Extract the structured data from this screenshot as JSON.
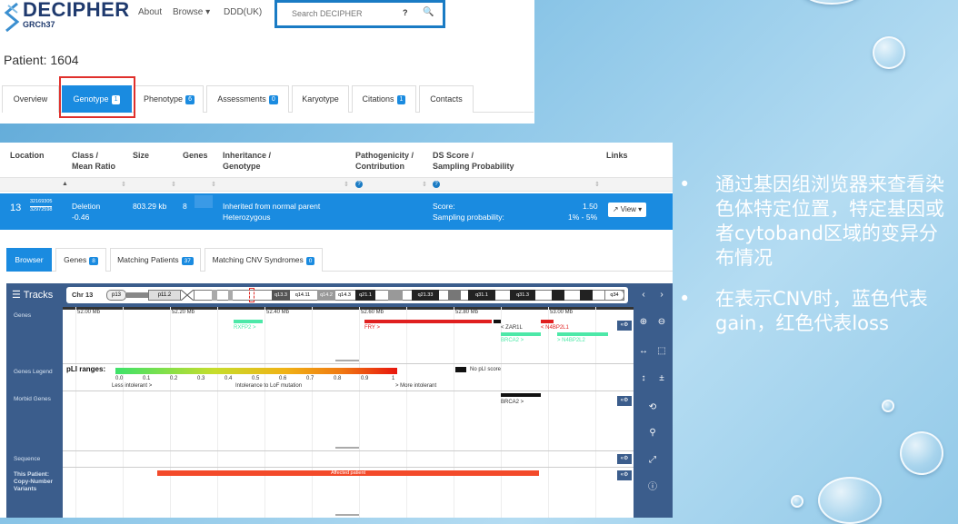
{
  "header": {
    "logo_text": "DECIPHER",
    "logo_sub": "GRCh37",
    "nav": [
      "About",
      "Browse ▾",
      "DDD(UK)"
    ],
    "search_placeholder": "Search DECIPHER",
    "help_icon": "?",
    "search_icon": "🔍"
  },
  "patient_label": "Patient: 1604",
  "tabs": [
    {
      "label": "Overview",
      "badge": ""
    },
    {
      "label": "Genotype",
      "badge": "1"
    },
    {
      "label": "Phenotype",
      "badge": "6"
    },
    {
      "label": "Assessments",
      "badge": "0"
    },
    {
      "label": "Karyotype",
      "badge": ""
    },
    {
      "label": "Citations",
      "badge": "1"
    },
    {
      "label": "Contacts",
      "badge": ""
    }
  ],
  "table": {
    "headers": {
      "location": "Location",
      "class": "Class /\nMean Ratio",
      "size": "Size",
      "genes": "Genes",
      "inheritance": "Inheritance /\nGenotype",
      "pathogenicity": "Pathogenicity /\nContribution",
      "ds": "DS Score /\nSampling Probability",
      "links": "Links"
    },
    "row": {
      "chr": "13",
      "start": "32169305",
      "end": "32972598",
      "class": "Deletion",
      "ratio": "-0.46",
      "size": "803.29 kb",
      "genes": "8",
      "inheritance": "Inherited from normal parent",
      "genotype": "Heterozygous",
      "score_label": "Score:",
      "score_value": "1.50",
      "sampling_label": "Sampling probability:",
      "sampling_value": "1% - 5%",
      "view": "View ▾"
    }
  },
  "subtabs": [
    {
      "label": "Browser",
      "badge": ""
    },
    {
      "label": "Genes",
      "badge": "8"
    },
    {
      "label": "Matching Patients",
      "badge": "37"
    },
    {
      "label": "Matching CNV Syndromes",
      "badge": "0"
    }
  ],
  "browser": {
    "tracks_label": "☰ Tracks",
    "chr_label": "Chr 13",
    "bands": [
      "p13",
      "p11.2",
      "q13.3",
      "q14.11",
      "q14.2",
      "q14.3",
      "q21.1",
      "q21.33",
      "q31.1",
      "q31.3",
      "q34"
    ],
    "ruler": [
      "52.00 Mb",
      "52.20 Mb",
      "52.40 Mb",
      "52.60 Mb",
      "52.80 Mb",
      "53.00 Mb"
    ],
    "row_labels": {
      "genes": "Genes",
      "genes_legend": "Genes Legend",
      "morbid": "Morbid Genes",
      "sequence": "Sequence",
      "patient": "This Patient:\nCopy-Number\nVariants"
    },
    "genes": [
      "RXFP2 >",
      "FRY >",
      "< ZAR1L",
      "BRCA2 >",
      "< N4BP2L1",
      "> N4BP2L2"
    ],
    "pli_title": "pLI ranges:",
    "pli_ticks": [
      "0.0",
      "0.1",
      "0.2",
      "0.3",
      "0.4",
      "0.5",
      "0.6",
      "0.7",
      "0.8",
      "0.9",
      "1"
    ],
    "pli_axis": [
      "Less intolerant >",
      "Intolerance to LoF mutation",
      "> More intolerant"
    ],
    "no_pli": "No pLI score",
    "morbid_gene": "BRCA2 >",
    "affected": "Affected patient"
  },
  "bullets": [
    "通过基因组浏览器来查看染色体特定位置，特定基因或者cytoband区域的变异分布情况",
    "在表示CNV时，蓝色代表gain，红色代表loss"
  ]
}
